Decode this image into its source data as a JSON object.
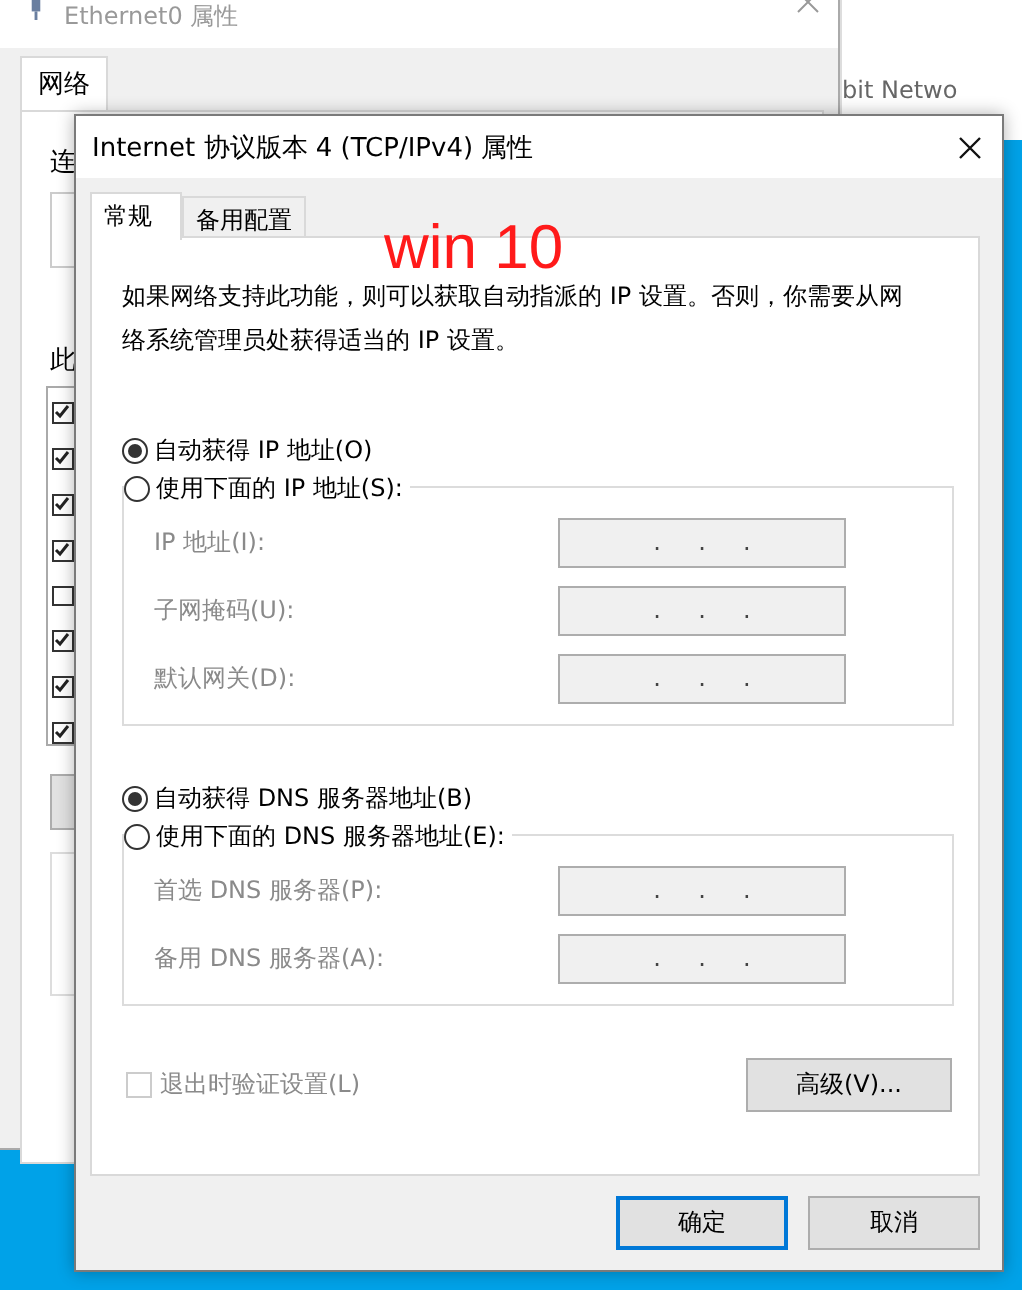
{
  "other_window": {
    "text": "bit Netwo"
  },
  "background_window": {
    "title": "Ethernet0 属性",
    "tabs": [
      {
        "label": "网络",
        "selected": true
      }
    ],
    "labels": [
      "连",
      "此"
    ],
    "items": [
      {
        "checked": true
      },
      {
        "checked": true
      },
      {
        "checked": true
      },
      {
        "checked": true
      },
      {
        "checked": false
      },
      {
        "checked": true
      },
      {
        "checked": true
      },
      {
        "checked": true
      }
    ]
  },
  "dialog": {
    "title": "Internet 协议版本 4 (TCP/IPv4) 属性",
    "tabs": [
      {
        "label": "常规",
        "selected": true
      },
      {
        "label": "备用配置",
        "selected": false
      }
    ],
    "description": "如果网络支持此功能，则可以获取自动指派的 IP 设置。否则，你需要从网络系统管理员处获得适当的 IP 设置。",
    "ip_options": [
      {
        "label": "自动获得 IP 地址(O)",
        "selected": true
      },
      {
        "label": "使用下面的 IP 地址(S):",
        "selected": false
      }
    ],
    "ip_fields": [
      {
        "label": "IP 地址(I):",
        "disabled": true,
        "separators": [
          ".",
          ".",
          "."
        ]
      },
      {
        "label": "子网掩码(U):",
        "disabled": true,
        "separators": [
          ".",
          ".",
          "."
        ]
      },
      {
        "label": "默认网关(D):",
        "disabled": true,
        "separators": [
          ".",
          ".",
          "."
        ]
      }
    ],
    "dns_options": [
      {
        "label": "自动获得 DNS 服务器地址(B)",
        "selected": true
      },
      {
        "label": "使用下面的 DNS 服务器地址(E):",
        "selected": false
      }
    ],
    "dns_fields": [
      {
        "label": "首选 DNS 服务器(P):",
        "disabled": true,
        "separators": [
          ".",
          ".",
          "."
        ]
      },
      {
        "label": "备用 DNS 服务器(A):",
        "disabled": true,
        "separators": [
          ".",
          ".",
          "."
        ]
      }
    ],
    "validate": {
      "label": "退出时验证设置(L)",
      "checked": false,
      "disabled": true
    },
    "advanced_button": "高级(V)...",
    "buttons": [
      {
        "label": "确定",
        "default": true
      },
      {
        "label": "取消",
        "default": false
      }
    ]
  },
  "annotation": {
    "text": "win 10"
  }
}
